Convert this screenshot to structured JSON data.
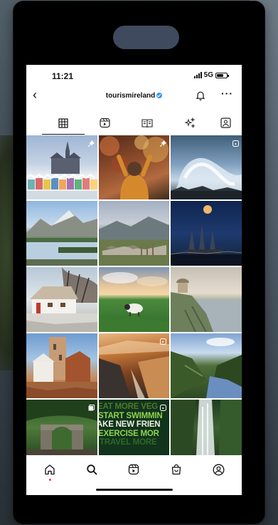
{
  "status_bar": {
    "time": "11:21",
    "network": "5G"
  },
  "profile": {
    "username": "tourismireland",
    "verified": true
  },
  "tabs": [
    "grid-icon",
    "reels-icon",
    "guides-icon",
    "effects-icon",
    "tagged-icon"
  ],
  "active_tab": "grid-icon",
  "grid": [
    {
      "name": "post-cathedral-cobh",
      "badge": "pin-icon"
    },
    {
      "name": "post-autumn-hiker",
      "badge": "pin-icon"
    },
    {
      "name": "post-crashing-wave",
      "badge": "reel-icon"
    },
    {
      "name": "post-mountain-lake"
    },
    {
      "name": "post-stone-wall-valley"
    },
    {
      "name": "post-moon-ship-ruins"
    },
    {
      "name": "post-thatched-cottage"
    },
    {
      "name": "post-sheep-sunset"
    },
    {
      "name": "post-mussenden-temple"
    },
    {
      "name": "post-castle-tower"
    },
    {
      "name": "post-coastal-cliffs",
      "badge": "reel-icon"
    },
    {
      "name": "post-green-valley"
    },
    {
      "name": "post-forest-gate",
      "badge": "multi-icon"
    },
    {
      "name": "post-text-motivation",
      "badge": "reel-icon"
    },
    {
      "name": "post-waterfall"
    }
  ],
  "text_tile": {
    "lines": [
      "EAT MORE VEG",
      "START SWIMMIN",
      "AKE NEW FRIEN",
      "EXERCISE MOR",
      "TRAVEL MORE"
    ]
  },
  "bottom_nav": [
    "home-icon",
    "search-icon",
    "reels-icon",
    "shop-icon",
    "profile-icon"
  ],
  "colors": {
    "verified": "#3897f0",
    "notification_dot": "#ff3040",
    "phone_frame": "#000000",
    "camera_pill": "#3f4a5e"
  }
}
